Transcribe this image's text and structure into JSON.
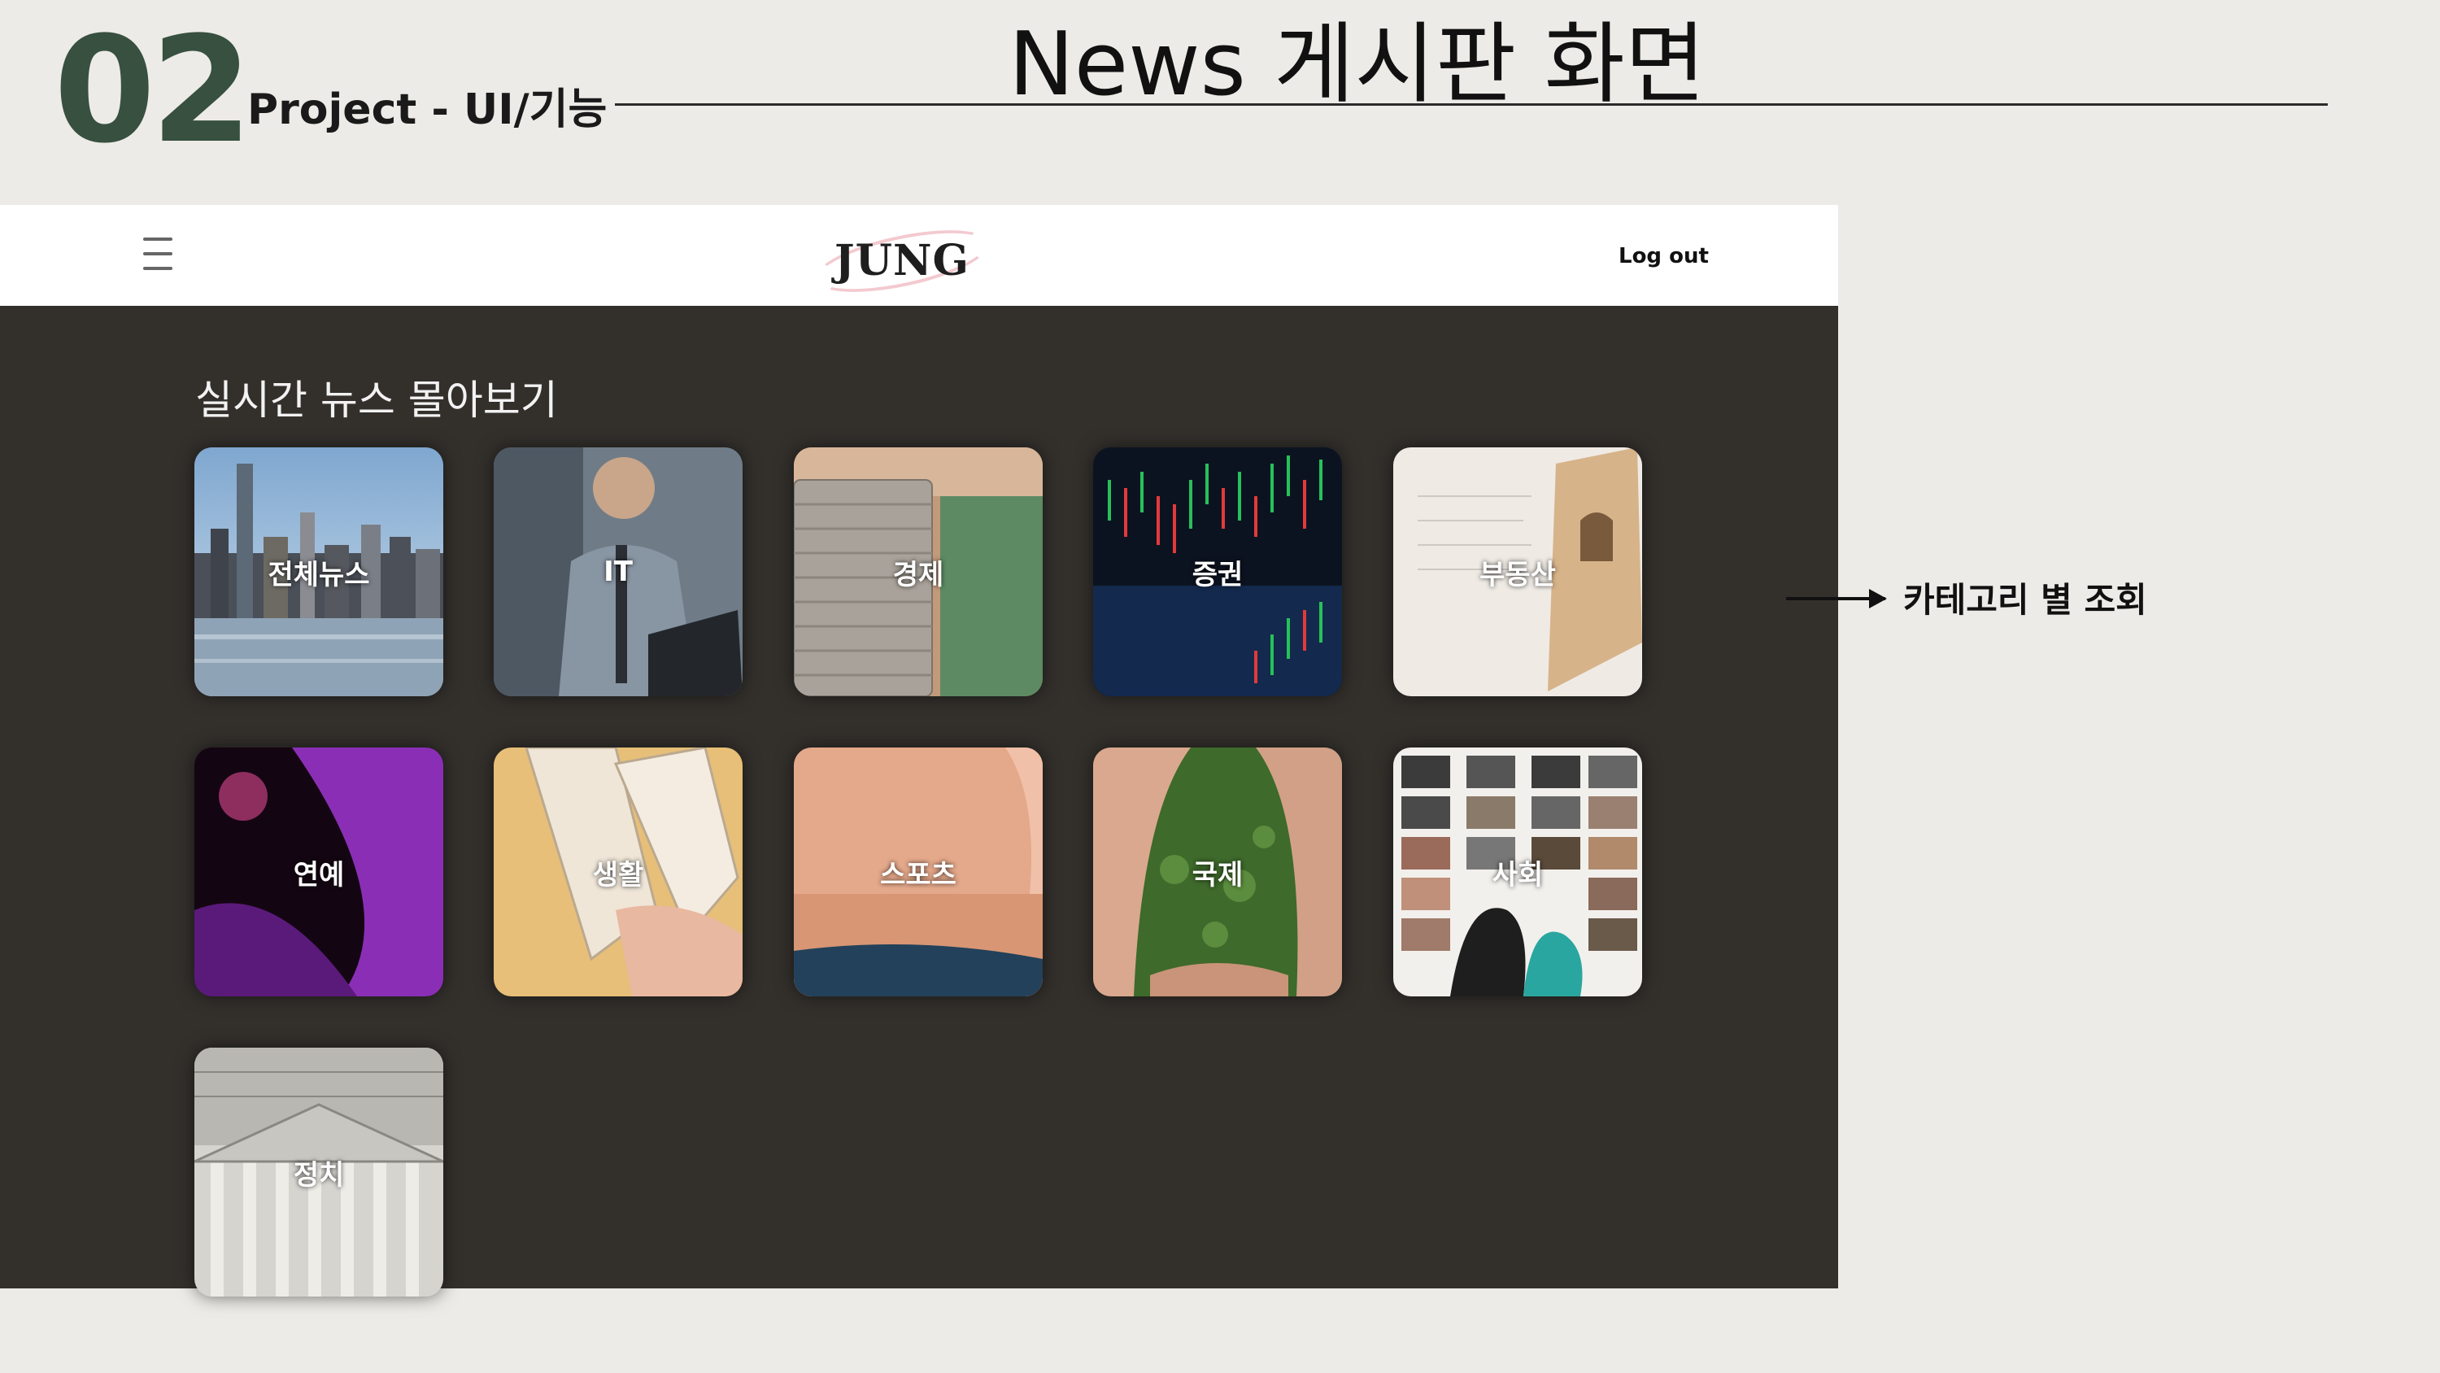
{
  "slide": {
    "number": "02",
    "subtitle": "Project - UI/기능",
    "title": "News 게시판 화면",
    "annotation": "카테고리 별 조회"
  },
  "nav": {
    "menu_icon": "hamburger-menu-icon",
    "logo_text": "JUNG",
    "logout_label": "Log out"
  },
  "section": {
    "title": "실시간 뉴스 몰아보기"
  },
  "categories": [
    {
      "label": "전체뉴스",
      "image": "city-skyline"
    },
    {
      "label": "IT",
      "image": "man-with-laptop"
    },
    {
      "label": "경제",
      "image": "coin-stack"
    },
    {
      "label": "증권",
      "image": "stock-chart"
    },
    {
      "label": "부동산",
      "image": "house-model"
    },
    {
      "label": "연예",
      "image": "purple-stage"
    },
    {
      "label": "생활",
      "image": "sneakers"
    },
    {
      "label": "스포츠",
      "image": "athlete-stretch"
    },
    {
      "label": "국제",
      "image": "hands-around-grass"
    },
    {
      "label": "사회",
      "image": "portrait-wall"
    },
    {
      "label": "정치",
      "image": "capitol-building"
    }
  ]
}
